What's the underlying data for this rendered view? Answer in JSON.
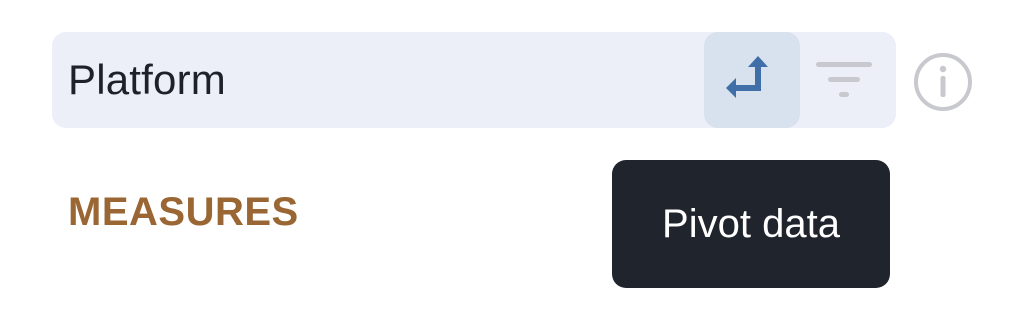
{
  "dimension": {
    "label": "Platform",
    "pivot_icon": "pivot-arrow-icon",
    "filter_icon": "filter-icon"
  },
  "info_icon": "info-icon",
  "measures": {
    "heading": "MEASURES"
  },
  "tooltip": {
    "text": "Pivot data"
  },
  "colors": {
    "bar_background": "#eceef8",
    "pivot_button_background": "#d7e2ee",
    "pivot_icon": "#3f6fa6",
    "muted_icon": "#c7c9ce",
    "heading": "#9a6634",
    "tooltip_background": "#20252d"
  }
}
